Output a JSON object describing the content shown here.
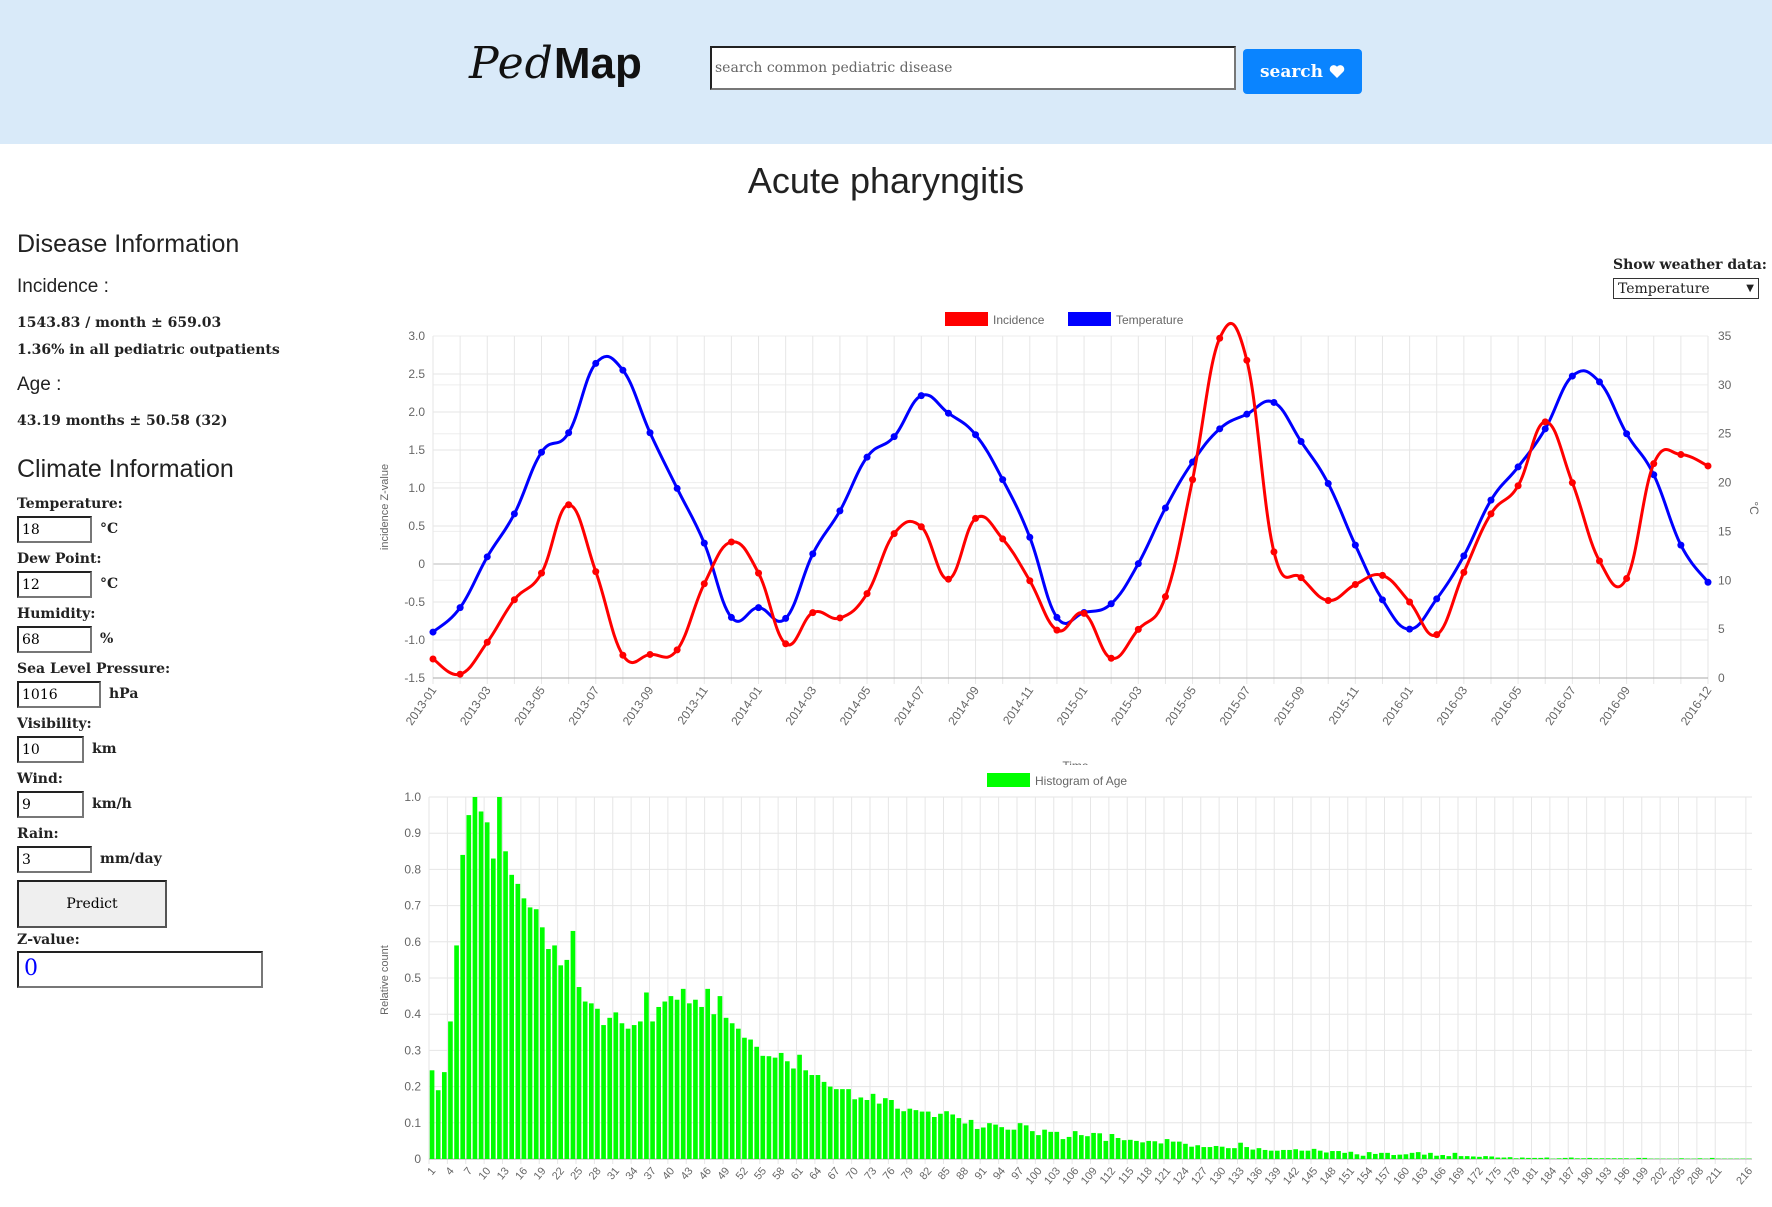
{
  "header": {
    "logo_ped": "Ped",
    "logo_map": "Map",
    "search_placeholder": "search common pediatric disease",
    "search_label": "search",
    "search_icon": "heart-icon"
  },
  "page_title": "Acute pharyngitis",
  "disease_info": {
    "heading": "Disease Information",
    "incidence_label": "Incidence :",
    "incidence_value": "1543.83 / month ± 659.03",
    "incidence_share": "1.36% in all pediatric outpatients",
    "age_label": "Age :",
    "age_value": "43.19 months ± 50.58 (32)"
  },
  "climate_info": {
    "heading": "Climate Information",
    "fields": [
      {
        "label": "Temperature:",
        "value": "18",
        "unit": "°C"
      },
      {
        "label": "Dew Point:",
        "value": "12",
        "unit": "°C"
      },
      {
        "label": "Humidity:",
        "value": "68",
        "unit": "%"
      },
      {
        "label": "Sea Level Pressure:",
        "value": "1016",
        "unit": "hPa"
      },
      {
        "label": "Visibility:",
        "value": "10",
        "unit": "km"
      },
      {
        "label": "Wind:",
        "value": "9",
        "unit": "km/h"
      },
      {
        "label": "Rain:",
        "value": "3",
        "unit": "mm/day"
      }
    ],
    "predict_label": "Predict",
    "zvalue_label": "Z-value:",
    "zvalue": "0"
  },
  "weather_selector": {
    "label": "Show weather data:",
    "selected": "Temperature"
  },
  "chart_data": [
    {
      "type": "line",
      "xlabel": "Time",
      "ylabel": "incidence Z-value",
      "y2label": "°C",
      "ylim": [
        -1.5,
        3.0
      ],
      "y2lim": [
        0,
        35
      ],
      "grid": true,
      "legend": "top",
      "x": [
        "2013-01",
        "2013-02",
        "2013-03",
        "2013-04",
        "2013-05",
        "2013-06",
        "2013-07",
        "2013-08",
        "2013-09",
        "2013-10",
        "2013-11",
        "2013-12",
        "2014-01",
        "2014-02",
        "2014-03",
        "2014-04",
        "2014-05",
        "2014-06",
        "2014-07",
        "2014-08",
        "2014-09",
        "2014-10",
        "2014-11",
        "2014-12",
        "2015-01",
        "2015-02",
        "2015-03",
        "2015-04",
        "2015-05",
        "2015-06",
        "2015-07",
        "2015-08",
        "2015-09",
        "2015-10",
        "2015-11",
        "2015-12",
        "2016-01",
        "2016-02",
        "2016-03",
        "2016-04",
        "2016-05",
        "2016-06",
        "2016-07",
        "2016-08",
        "2016-09",
        "2016-10",
        "2016-11",
        "2016-12"
      ],
      "x_tick_labels": [
        "2013-01",
        "2013-03",
        "2013-05",
        "2013-07",
        "2013-09",
        "2013-11",
        "2014-01",
        "2014-03",
        "2014-05",
        "2014-07",
        "2014-09",
        "2014-11",
        "2015-01",
        "2015-03",
        "2015-05",
        "2015-07",
        "2015-09",
        "2015-11",
        "2016-01",
        "2016-03",
        "2016-05",
        "2016-07",
        "2016-09",
        "2016-12"
      ],
      "y_tick_labels": [
        "3.0",
        "2.5",
        "2.0",
        "1.5",
        "1.0",
        "0.5",
        "0",
        "-0.5",
        "-1.0",
        "-1.5"
      ],
      "y2_tick_labels": [
        "35",
        "30",
        "25",
        "20",
        "15",
        "10",
        "5",
        "0"
      ],
      "series": [
        {
          "name": "Incidence",
          "axis": "left",
          "color": "#ff0000",
          "values": [
            -1.25,
            -1.45,
            -1.03,
            -0.47,
            -0.12,
            0.78,
            -0.1,
            -1.2,
            -1.19,
            -1.13,
            -0.26,
            0.29,
            -0.12,
            -1.05,
            -0.64,
            -0.71,
            -0.39,
            0.4,
            0.49,
            -0.2,
            0.6,
            0.33,
            -0.22,
            -0.87,
            -0.65,
            -1.24,
            -0.86,
            -0.43,
            1.11,
            2.97,
            2.68,
            0.16,
            -0.18,
            -0.48,
            -0.27,
            -0.15,
            -0.5,
            -0.93,
            -0.11,
            0.66,
            1.03,
            1.87,
            1.07,
            0.04,
            -0.19,
            1.32,
            1.44,
            1.29
          ]
        },
        {
          "name": "Temperature",
          "axis": "right",
          "color": "#0000ff",
          "values": [
            4.7,
            7.2,
            12.4,
            16.8,
            23.1,
            25.1,
            32.2,
            31.5,
            25.1,
            19.4,
            13.8,
            6.2,
            7.2,
            6.1,
            12.7,
            17.1,
            22.6,
            24.7,
            28.9,
            27.1,
            24.9,
            20.3,
            14.4,
            6.2,
            6.7,
            7.6,
            11.7,
            17.4,
            22.1,
            25.5,
            27.0,
            28.2,
            24.2,
            19.9,
            13.6,
            8.0,
            5.0,
            8.1,
            12.5,
            18.2,
            21.6,
            25.5,
            30.9,
            30.3,
            25.0,
            20.8,
            13.6,
            9.8
          ]
        }
      ]
    },
    {
      "type": "bar",
      "ylabel": "Relative count",
      "ylim": [
        0,
        1.0
      ],
      "grid": true,
      "legend": "top",
      "y_tick_labels": [
        "1.0",
        "0.9",
        "0.8",
        "0.7",
        "0.6",
        "0.5",
        "0.4",
        "0.3",
        "0.2",
        "0.1",
        "0"
      ],
      "x_tick_labels": [
        "1",
        "4",
        "7",
        "10",
        "13",
        "16",
        "19",
        "22",
        "25",
        "28",
        "31",
        "34",
        "37",
        "40",
        "43",
        "46",
        "49",
        "52",
        "55",
        "58",
        "61",
        "64",
        "67",
        "70",
        "73",
        "76",
        "79",
        "82",
        "85",
        "88",
        "91",
        "94",
        "97",
        "100",
        "103",
        "106",
        "109",
        "112",
        "115",
        "118",
        "121",
        "124",
        "127",
        "130",
        "133",
        "136",
        "139",
        "142",
        "145",
        "148",
        "151",
        "154",
        "157",
        "160",
        "163",
        "166",
        "169",
        "172",
        "175",
        "178",
        "181",
        "184",
        "187",
        "190",
        "193",
        "196",
        "199",
        "202",
        "205",
        "208",
        "211",
        "216"
      ],
      "series": [
        {
          "name": "Histogram of Age",
          "color": "#00ff00",
          "values": [
            0.245,
            0.19,
            0.24,
            0.38,
            0.59,
            0.84,
            0.95,
            1.0,
            0.96,
            0.93,
            0.83,
            1.0,
            0.85,
            0.785,
            0.76,
            0.72,
            0.695,
            0.69,
            0.64,
            0.58,
            0.59,
            0.535,
            0.55,
            0.63,
            0.475,
            0.435,
            0.43,
            0.415,
            0.37,
            0.39,
            0.405,
            0.375,
            0.36,
            0.37,
            0.38,
            0.46,
            0.38,
            0.42,
            0.435,
            0.45,
            0.44,
            0.47,
            0.43,
            0.44,
            0.42,
            0.47,
            0.4,
            0.45,
            0.39,
            0.375,
            0.36,
            0.335,
            0.33,
            0.31,
            0.285,
            0.284,
            0.28,
            0.293,
            0.27,
            0.25,
            0.288,
            0.245,
            0.232,
            0.232,
            0.213,
            0.2,
            0.193,
            0.193,
            0.193,
            0.165,
            0.17,
            0.163,
            0.18,
            0.153,
            0.168,
            0.163,
            0.139,
            0.132,
            0.139,
            0.135,
            0.131,
            0.131,
            0.116,
            0.125,
            0.132,
            0.123,
            0.113,
            0.098,
            0.108,
            0.083,
            0.087,
            0.099,
            0.095,
            0.088,
            0.081,
            0.081,
            0.099,
            0.093,
            0.077,
            0.066,
            0.081,
            0.075,
            0.075,
            0.055,
            0.061,
            0.077,
            0.066,
            0.063,
            0.072,
            0.071,
            0.05,
            0.069,
            0.058,
            0.052,
            0.053,
            0.05,
            0.046,
            0.05,
            0.049,
            0.043,
            0.055,
            0.048,
            0.048,
            0.042,
            0.034,
            0.038,
            0.033,
            0.033,
            0.036,
            0.034,
            0.03,
            0.03,
            0.045,
            0.033,
            0.026,
            0.03,
            0.025,
            0.023,
            0.023,
            0.025,
            0.025,
            0.027,
            0.023,
            0.023,
            0.028,
            0.023,
            0.018,
            0.022,
            0.022,
            0.017,
            0.02,
            0.013,
            0.009,
            0.019,
            0.014,
            0.017,
            0.017,
            0.011,
            0.012,
            0.013,
            0.017,
            0.019,
            0.012,
            0.017,
            0.009,
            0.011,
            0.008,
            0.017,
            0.008,
            0.008,
            0.007,
            0.006,
            0.008,
            0.007,
            0.004,
            0.004,
            0.005,
            0.002,
            0.004,
            0.003,
            0.003,
            0.003,
            0.004,
            0.001,
            0.002,
            0.003,
            0.004,
            0.002,
            0.002,
            0.003,
            0.002,
            0.002,
            0.002,
            0.002,
            0.002,
            0.002,
            0.001,
            0.003,
            0.003,
            0.001,
            0.001,
            0.001,
            0.001,
            0.001,
            0.002,
            0.001,
            0.001,
            0.002,
            0.001,
            0.003,
            0.001,
            0.001,
            0.001,
            0.001,
            0.001,
            0.001
          ]
        }
      ]
    }
  ]
}
